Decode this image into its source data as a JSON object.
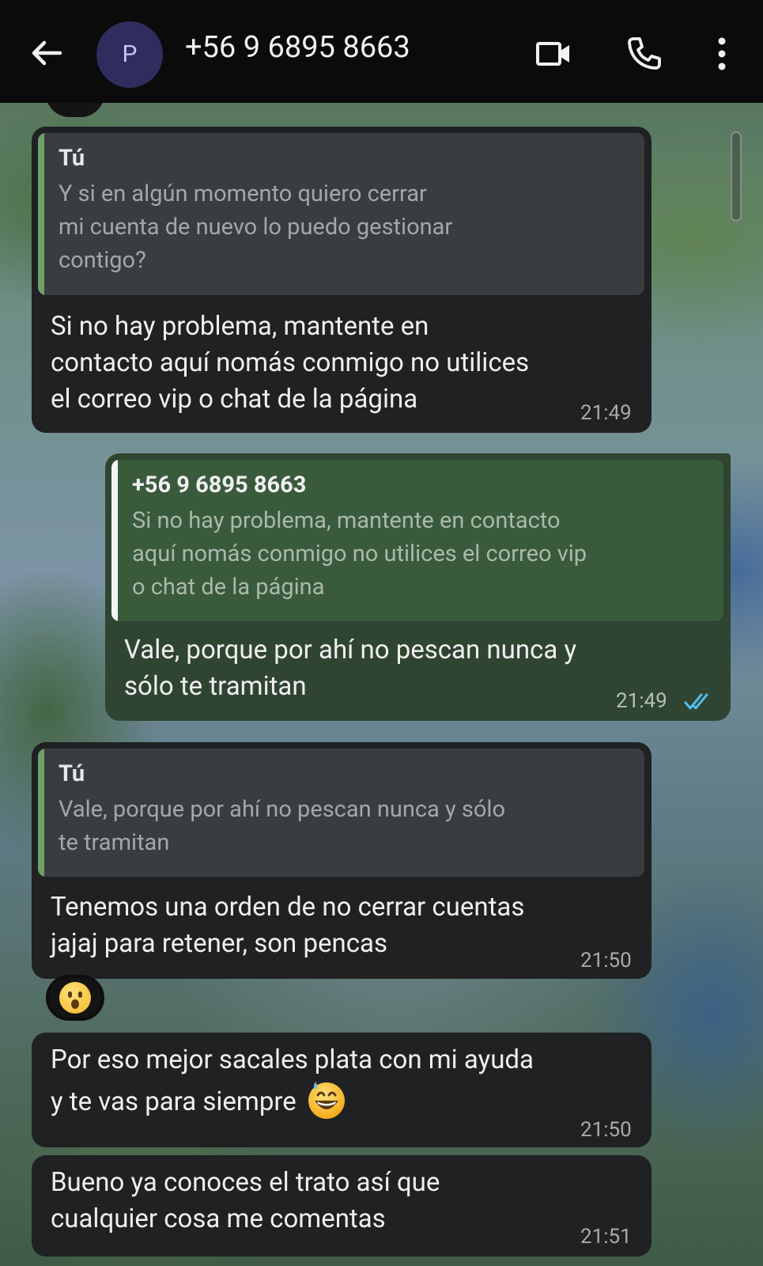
{
  "header": {
    "avatar_letter": "P",
    "contact_name": "+56 9 6895 8663"
  },
  "messages": [
    {
      "direction": "in",
      "quote_author": "Tú",
      "quote_text_lines": [
        "Y si en algún momento quiero cerrar",
        "mi cuenta de nuevo lo puedo gestionar",
        "contigo?"
      ],
      "text_lines": [
        "Si no hay problema, mantente en",
        "contacto aquí nomás conmigo no utilices",
        "el correo vip o chat de la página"
      ],
      "time": "21:49"
    },
    {
      "direction": "out",
      "quote_author": "+56 9 6895 8663",
      "quote_text_lines": [
        "Si no hay problema, mantente en contacto",
        "aquí nomás conmigo no utilices el correo vip",
        "o chat de la página"
      ],
      "text_lines": [
        "Vale, porque por ahí no pescan nunca y",
        "sólo te tramitan"
      ],
      "time": "21:49",
      "status": "read"
    },
    {
      "direction": "in",
      "quote_author": "Tú",
      "quote_text_lines": [
        "Vale, porque por ahí no pescan nunca y sólo",
        "te tramitan"
      ],
      "text_lines": [
        "Tenemos una orden de no cerrar cuentas",
        "jajaj para retener, son pencas"
      ],
      "time": "21:50",
      "reaction": "surprised-face-emoji"
    },
    {
      "direction": "in",
      "text_lines": [
        "Por eso mejor sacales plata con mi ayuda",
        "y te vas para siempre"
      ],
      "emoji": "grinning-face-with-sweat-emoji",
      "time": "21:50"
    },
    {
      "direction": "in",
      "text_lines": [
        "Bueno ya conoces el trato así que",
        "cualquier cosa me comentas"
      ],
      "time": "21:51"
    }
  ],
  "colors": {
    "incoming_bubble": "#1f2123",
    "outgoing_bubble": "#2f4532",
    "read_ticks": "#53bdeb",
    "header_bg": "#0b0b0b"
  }
}
